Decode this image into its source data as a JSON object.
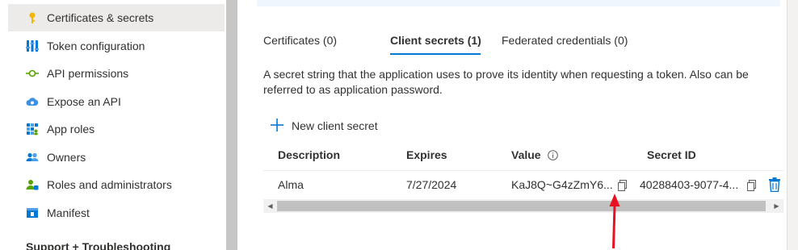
{
  "sidebar": {
    "items": [
      {
        "label": "Certificates & secrets",
        "icon": "key-icon",
        "active": true
      },
      {
        "label": "Token configuration",
        "icon": "token-config-icon",
        "active": false
      },
      {
        "label": "API permissions",
        "icon": "api-permissions-icon",
        "active": false
      },
      {
        "label": "Expose an API",
        "icon": "cloud-icon",
        "active": false
      },
      {
        "label": "App roles",
        "icon": "app-roles-icon",
        "active": false
      },
      {
        "label": "Owners",
        "icon": "owners-icon",
        "active": false
      },
      {
        "label": "Roles and administrators",
        "icon": "roles-admin-icon",
        "active": false
      },
      {
        "label": "Manifest",
        "icon": "manifest-icon",
        "active": false
      }
    ],
    "section_header": "Support + Troubleshooting"
  },
  "tabs": [
    {
      "label": "Certificates (0)",
      "active": false
    },
    {
      "label": "Client secrets (1)",
      "active": true
    },
    {
      "label": "Federated credentials (0)",
      "active": false
    }
  ],
  "description": "A secret string that the application uses to prove its identity when requesting a token. Also can be referred to as application password.",
  "new_secret_label": "New client secret",
  "table": {
    "headers": [
      "Description",
      "Expires",
      "Value",
      "Secret ID"
    ],
    "rows": [
      {
        "description": "Alma",
        "expires": "7/27/2024",
        "value": "KaJ8Q~G4zZmY6...",
        "secret_id": "40288403-9077-4..."
      }
    ]
  },
  "colors": {
    "accent": "#0078d4",
    "annotation_arrow": "#e81123",
    "active_nav_bg": "#edebe9",
    "delete_icon": "#0078d4"
  }
}
